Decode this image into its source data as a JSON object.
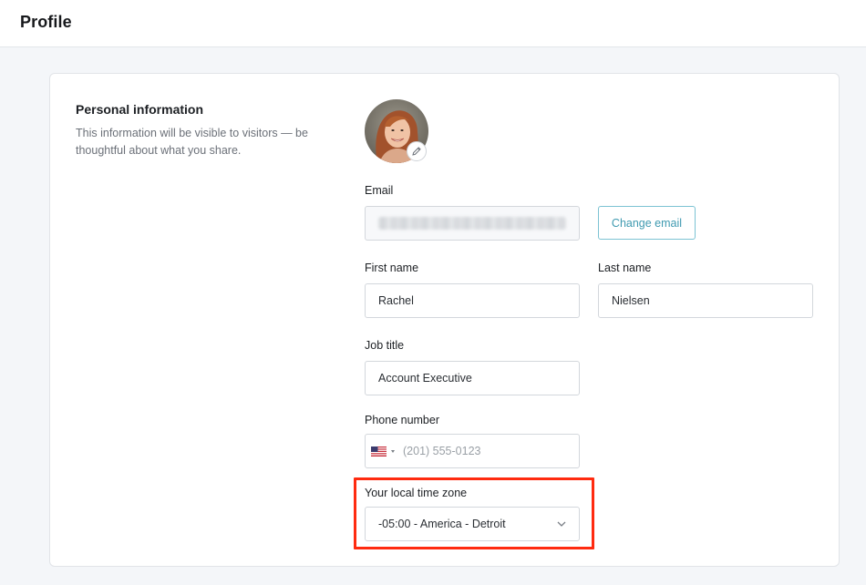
{
  "header": {
    "title": "Profile"
  },
  "section": {
    "title": "Personal information",
    "description": "This information will be visible to visitors — be thoughtful about what you share."
  },
  "email": {
    "label": "Email",
    "change_button": "Change email"
  },
  "first_name": {
    "label": "First name",
    "value": "Rachel"
  },
  "last_name": {
    "label": "Last name",
    "value": "Nielsen"
  },
  "job_title": {
    "label": "Job title",
    "value": "Account Executive"
  },
  "phone": {
    "label": "Phone number",
    "placeholder": "(201) 555-0123"
  },
  "timezone": {
    "label": "Your local time zone",
    "value": "-05:00 - America - Detroit"
  },
  "colors": {
    "accent": "#3f9ab0",
    "highlight": "#ff2b10"
  },
  "icons": {
    "avatar_edit": "pencil-icon",
    "country": "us-flag-icon",
    "select_caret": "chevron-down-icon"
  }
}
